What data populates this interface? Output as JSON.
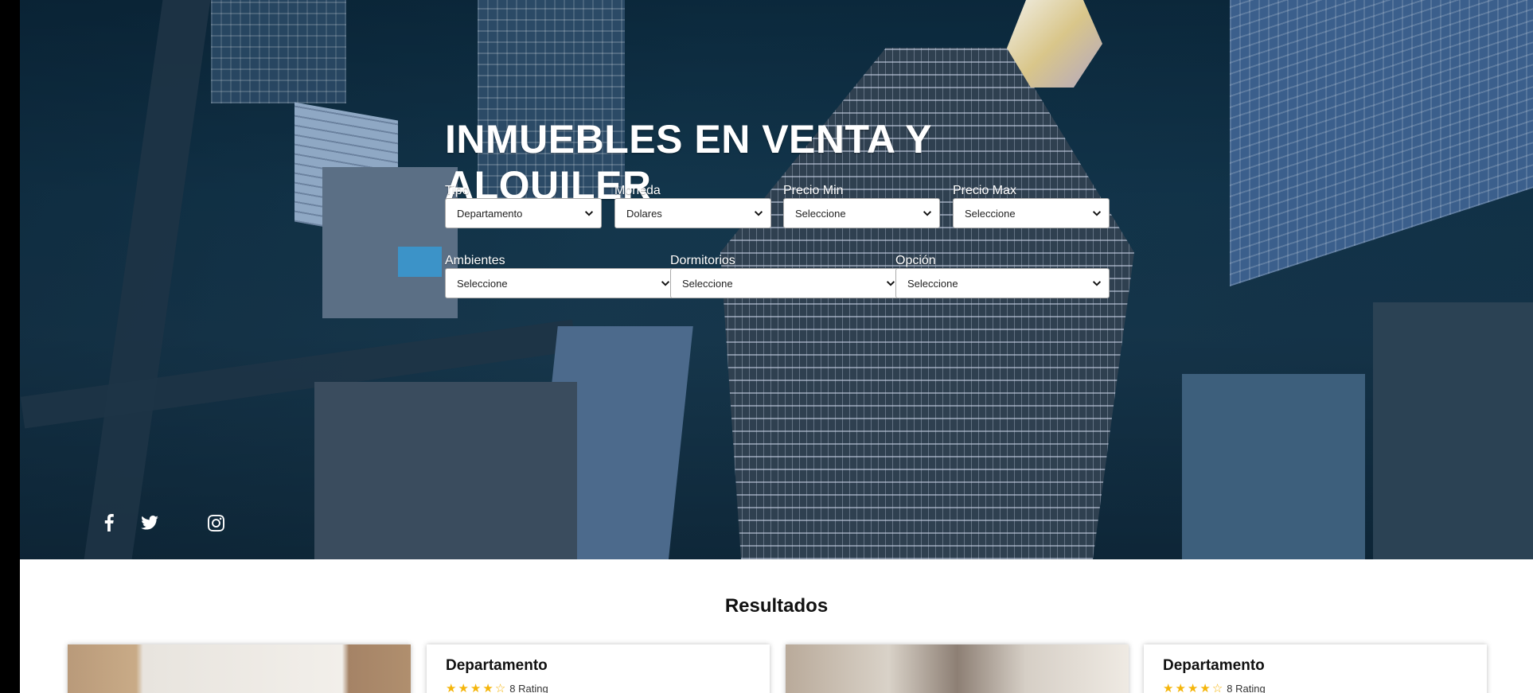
{
  "hero": {
    "title": "INMUEBLES EN VENTA Y ALQUILER"
  },
  "filters": {
    "tipo": {
      "label": "Tipo",
      "value": "Departamento"
    },
    "moneda": {
      "label": "Moneda",
      "value": "Dolares"
    },
    "precio_min": {
      "label": "Precio Min",
      "value": "Seleccione"
    },
    "precio_max": {
      "label": "Precio Max",
      "value": "Seleccione"
    },
    "ambientes": {
      "label": "Ambientes",
      "value": "Seleccione"
    },
    "dormitorios": {
      "label": "Dormitorios",
      "value": "Seleccione"
    },
    "opcion": {
      "label": "Opción",
      "value": "Seleccione"
    }
  },
  "social": {
    "icons": [
      "facebook-icon",
      "twitter-icon",
      "instagram-icon"
    ],
    "color": "#ffffff"
  },
  "results": {
    "title": "Resultados",
    "cards": [
      {
        "kind": "photo"
      },
      {
        "kind": "info",
        "title": "Departamento",
        "rating_text": "8 Rating",
        "stars_filled": 4,
        "stars_total": 5
      },
      {
        "kind": "photo"
      },
      {
        "kind": "info",
        "title": "Departamento",
        "rating_text": "8 Rating",
        "stars_filled": 4,
        "stars_total": 5
      }
    ]
  },
  "colors": {
    "star": "#f5b50a",
    "hero_overlay": "#0c2b3f"
  }
}
